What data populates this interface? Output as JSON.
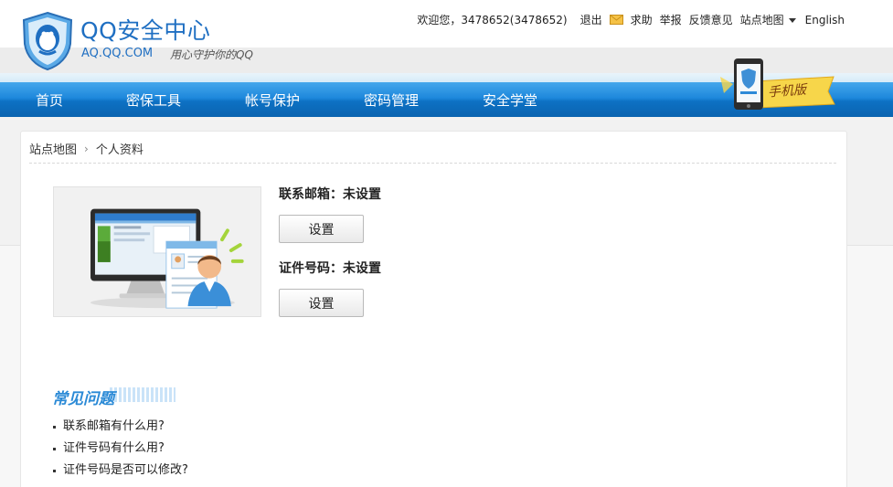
{
  "header": {
    "title": "QQ安全中心",
    "url": "AQ.QQ.COM",
    "slogan": "用心守护你的QQ"
  },
  "toplinks": {
    "welcome": "欢迎您，3478652(3478652)",
    "logout": "退出",
    "help": "求助",
    "report": "举报",
    "feedback": "反馈意见",
    "sitemap": "站点地图",
    "english": "English"
  },
  "nav": {
    "items": [
      "首页",
      "密保工具",
      "帐号保护",
      "密码管理",
      "安全学堂"
    ]
  },
  "mobile": {
    "label": "手机版"
  },
  "breadcrumb": {
    "root": "站点地图",
    "current": "个人资料"
  },
  "profile": {
    "email_label": "联系邮箱：未设置",
    "email_button": "设置",
    "id_label": "证件号码：未设置",
    "id_button": "设置"
  },
  "faq": {
    "title": "常见问题",
    "items": [
      "联系邮箱有什么用?",
      "证件号码有什么用?",
      "证件号码是否可以修改?"
    ]
  },
  "colors": {
    "brand_blue": "#1f6fc2",
    "nav_blue": "#1e88dc",
    "faq_blue": "#2b8ad6"
  }
}
